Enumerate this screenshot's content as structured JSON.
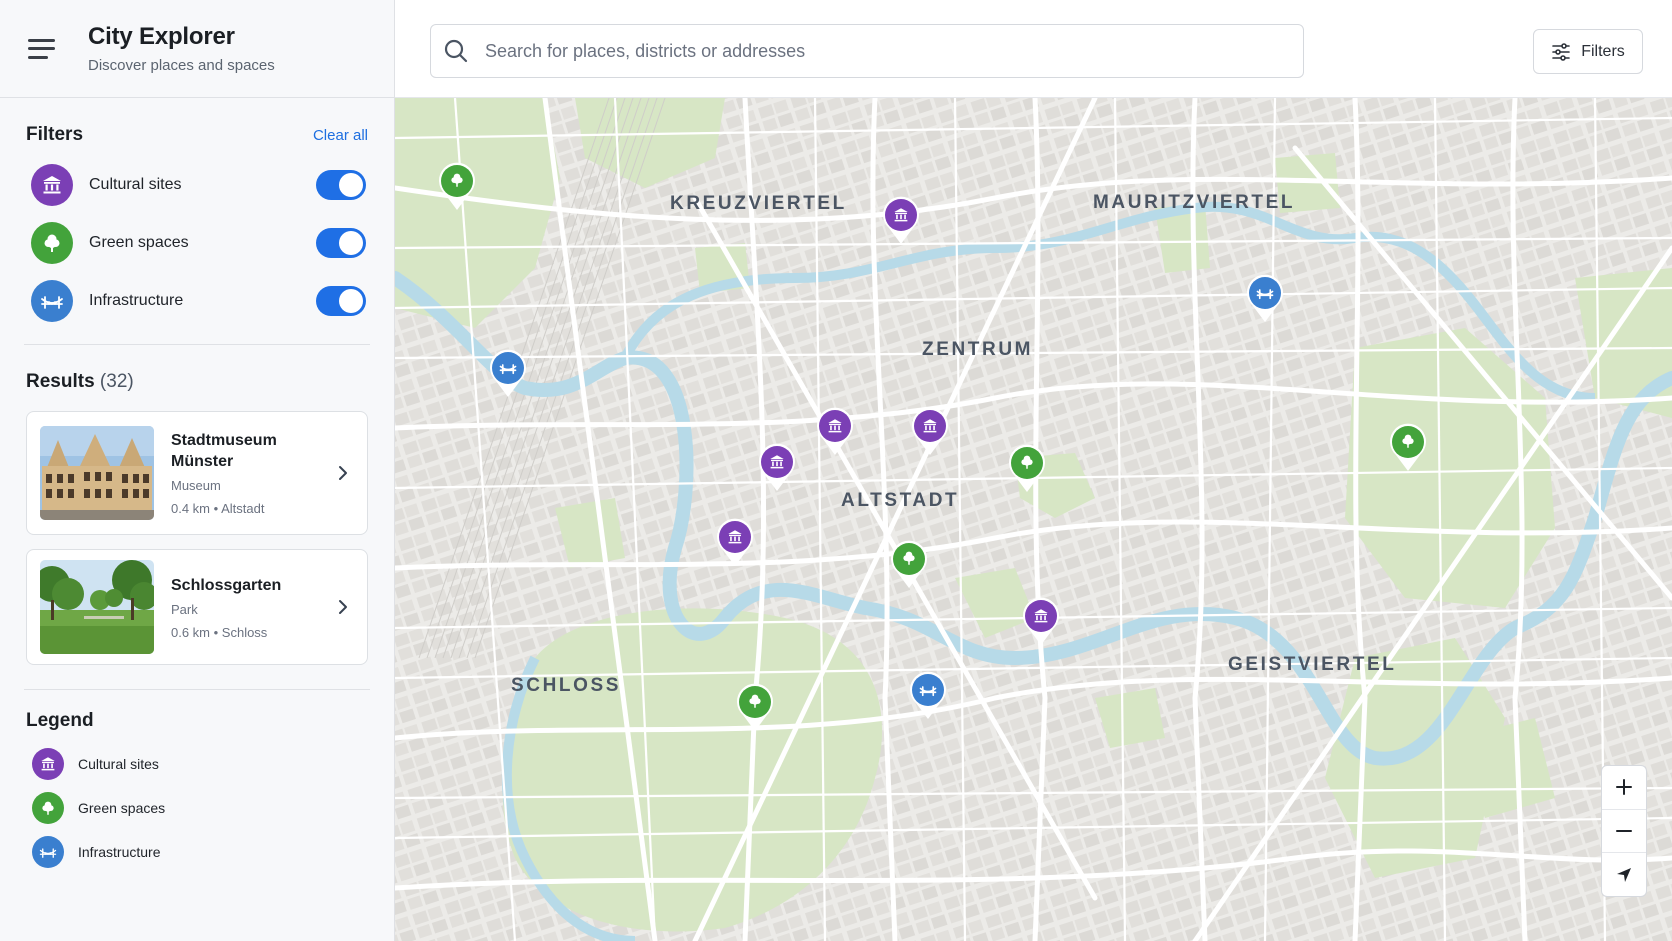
{
  "header": {
    "title": "City Explorer",
    "subtitle": "Discover places and spaces",
    "menu_icon": "hamburger-menu-icon"
  },
  "search": {
    "placeholder": "Search for places, districts or addresses",
    "value": ""
  },
  "toolbar": {
    "filters_label": "Filters"
  },
  "filters": {
    "title": "Filters",
    "clear_all": "Clear all",
    "items": [
      {
        "label": "Cultural sites",
        "icon": "museum-icon",
        "enabled": true,
        "color": "#7b3fb5"
      },
      {
        "label": "Green spaces",
        "icon": "tree-icon",
        "enabled": true,
        "color": "#43a33b"
      },
      {
        "label": "Infrastructure",
        "icon": "bridge-icon",
        "enabled": true,
        "color": "#3a7fcf"
      }
    ]
  },
  "results": {
    "title": "Results",
    "count": "(32)",
    "items": [
      {
        "title": "Stadtmuseum Münster",
        "type": "Museum",
        "distance": "0.4 km",
        "area": "Altstadt",
        "meta": "0.4 km • Altstadt"
      },
      {
        "title": "Schlossgarten",
        "type": "Park",
        "distance": "0.6 km",
        "area": "Schloss",
        "meta": "0.6 km • Schloss"
      }
    ]
  },
  "legend": {
    "title": "Legend",
    "items": [
      {
        "label": "Cultural sites",
        "icon": "museum-icon"
      },
      {
        "label": "Green spaces",
        "icon": "tree-icon"
      },
      {
        "label": "Infrastructure",
        "icon": "bridge-icon"
      }
    ]
  },
  "map": {
    "districts": [
      "KREUZVIERTEL",
      "MAURITZVIERTEL",
      "ZENTRUM",
      "ALTSTADT",
      "SCHLOSS",
      "GEISTVIERTEL"
    ],
    "controls": {
      "zoom_in": "zoom-in-icon",
      "zoom_out": "zoom-out-icon",
      "locate": "locate-icon"
    }
  },
  "colors": {
    "accent": "#1f6fe5",
    "cultural": "#7b3fb5",
    "green": "#43a33b",
    "infrastructure": "#3a7fcf",
    "park_fill": "#d9e8c8",
    "water": "#b7dae8"
  }
}
